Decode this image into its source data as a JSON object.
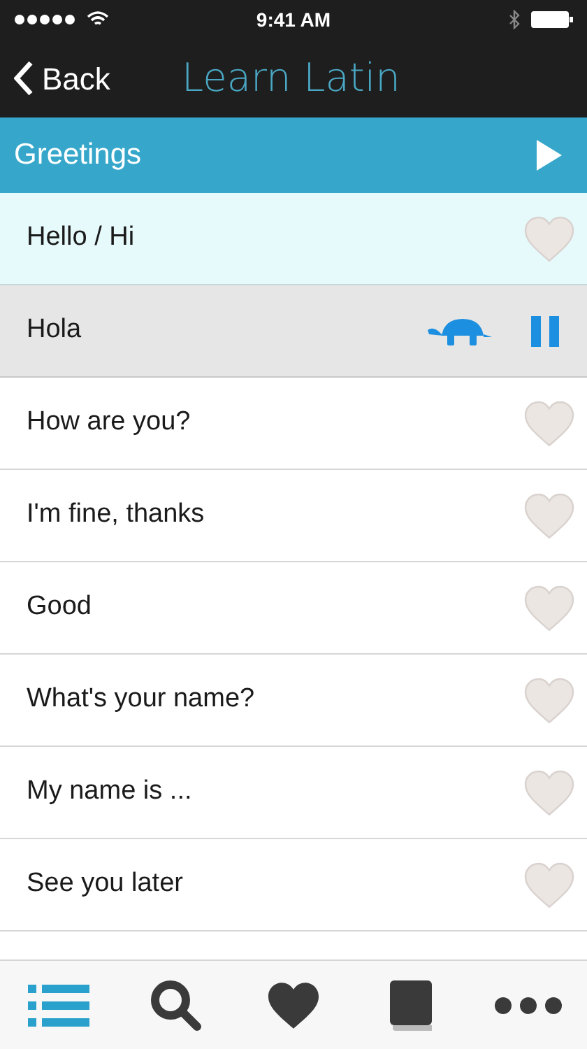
{
  "status_bar": {
    "time": "9:41 AM"
  },
  "nav_bar": {
    "back": "Back",
    "title": "Learn Latin"
  },
  "section": {
    "title": "Greetings"
  },
  "phrases": [
    {
      "text": "Hello / Hi",
      "selected": true,
      "playing": false
    },
    {
      "text": "Hola",
      "selected": false,
      "playing": true
    },
    {
      "text": "How are you?",
      "selected": false,
      "playing": false
    },
    {
      "text": "I'm fine, thanks",
      "selected": false,
      "playing": false
    },
    {
      "text": "Good",
      "selected": false,
      "playing": false
    },
    {
      "text": "What's your name?",
      "selected": false,
      "playing": false
    },
    {
      "text": "My name is ...",
      "selected": false,
      "playing": false
    },
    {
      "text": "See you later",
      "selected": false,
      "playing": false
    }
  ],
  "tab_bar": [
    {
      "kind": "list",
      "selected": true
    },
    {
      "kind": "search",
      "selected": false
    },
    {
      "kind": "heart",
      "selected": false
    },
    {
      "kind": "book",
      "selected": false
    },
    {
      "kind": "more",
      "selected": false
    }
  ]
}
